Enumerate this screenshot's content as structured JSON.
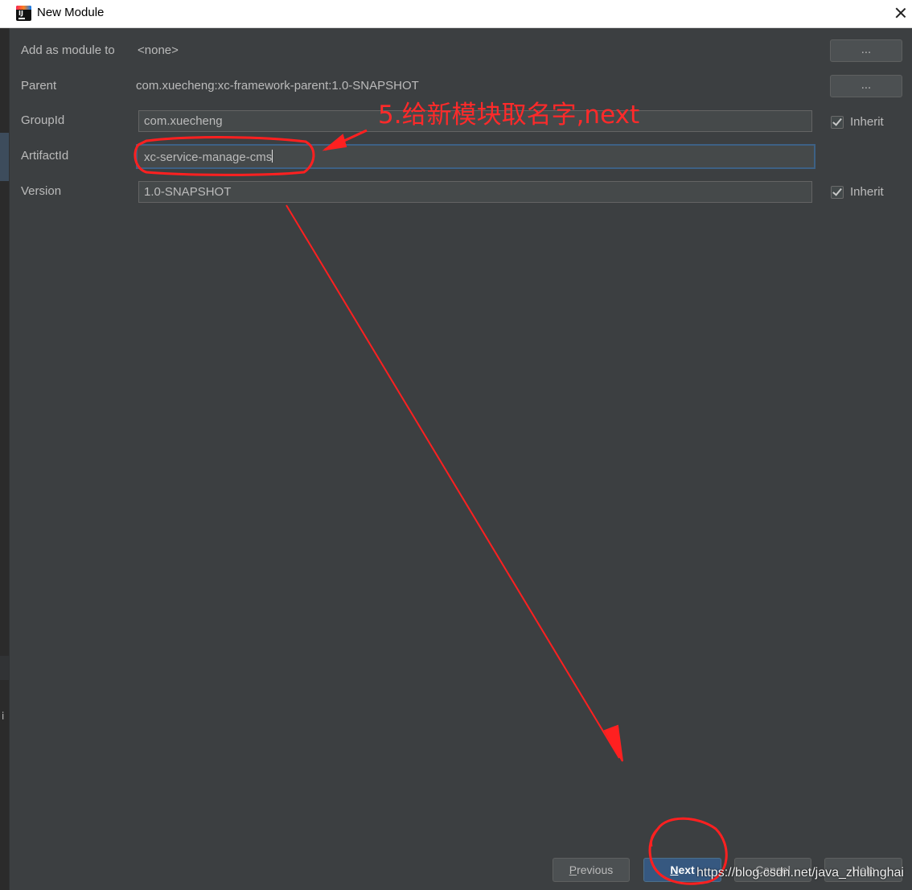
{
  "window": {
    "title": "New Module",
    "close_icon": "close-icon",
    "app_icon": "intellij-idea-icon"
  },
  "app_icon_text": "IJ",
  "form": {
    "add_as_module_to": {
      "label": "Add as module to",
      "value": "<none>",
      "button": "..."
    },
    "parent": {
      "label": "Parent",
      "value": "com.xuecheng:xc-framework-parent:1.0-SNAPSHOT",
      "button": "..."
    },
    "group_id": {
      "label": "GroupId",
      "value": "com.xuecheng",
      "inherit_label": "Inherit",
      "inherit_checked": true
    },
    "artifact_id": {
      "label": "ArtifactId",
      "value": "xc-service-manage-cms"
    },
    "version": {
      "label": "Version",
      "value": "1.0-SNAPSHOT",
      "inherit_label": "Inherit",
      "inherit_checked": true
    }
  },
  "buttons": {
    "previous": {
      "mnemonic": "P",
      "rest": "revious"
    },
    "next": {
      "mnemonic": "N",
      "rest": "ext"
    },
    "cancel": "Cancel",
    "help": "Help"
  },
  "annotation": {
    "text": "5.给新模块取名字,next",
    "color": "#ff2a2a"
  },
  "watermark": "https://blog.csdn.net/java_zhulinghai",
  "left_strip_glyph": "i",
  "colors": {
    "background": "#3c3f41",
    "field": "#45494a",
    "focus_border": "#3d6185",
    "primary_button": "#365880"
  }
}
